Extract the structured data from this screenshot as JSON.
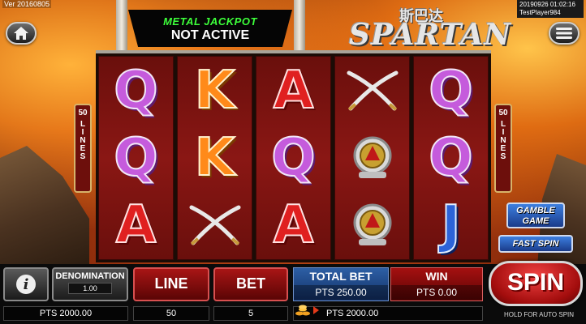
{
  "version": "Ver 20160805",
  "session": {
    "datetime": "20190926 01:02:16",
    "player": "TestPlayer984"
  },
  "jackpot": {
    "title": "METAL JACKPOT",
    "status": "NOT ACTIVE"
  },
  "logo": {
    "chinese": "斯巴达",
    "english": "SPARTAN"
  },
  "lines_indicator": {
    "count": "50",
    "word": "LINES"
  },
  "reels": [
    [
      "Q",
      "Q",
      "A"
    ],
    [
      "K",
      "K",
      "swords"
    ],
    [
      "A",
      "Q",
      "A"
    ],
    [
      "swords",
      "ring",
      "ring"
    ],
    [
      "Q",
      "Q",
      "J"
    ]
  ],
  "side_buttons": {
    "gamble_line1": "GAMBLE",
    "gamble_line2": "GAME",
    "fast_spin": "FAST SPIN"
  },
  "controls": {
    "denomination_label": "DENOMINATION",
    "denomination_value": "1.00",
    "line_label": "LINE",
    "line_value": "50",
    "bet_label": "BET",
    "bet_value": "5",
    "total_bet_label": "TOTAL BET",
    "total_bet_value": "PTS 250.00",
    "win_label": "WIN",
    "win_value": "PTS 0.00",
    "credits": "PTS 2000.00",
    "balance": "PTS 2000.00",
    "spin_label": "SPIN",
    "hold_hint": "HOLD FOR AUTO SPIN"
  },
  "icons": [
    "home-icon",
    "menu-icon",
    "info-icon",
    "coins-icon",
    "arrow-icon"
  ]
}
